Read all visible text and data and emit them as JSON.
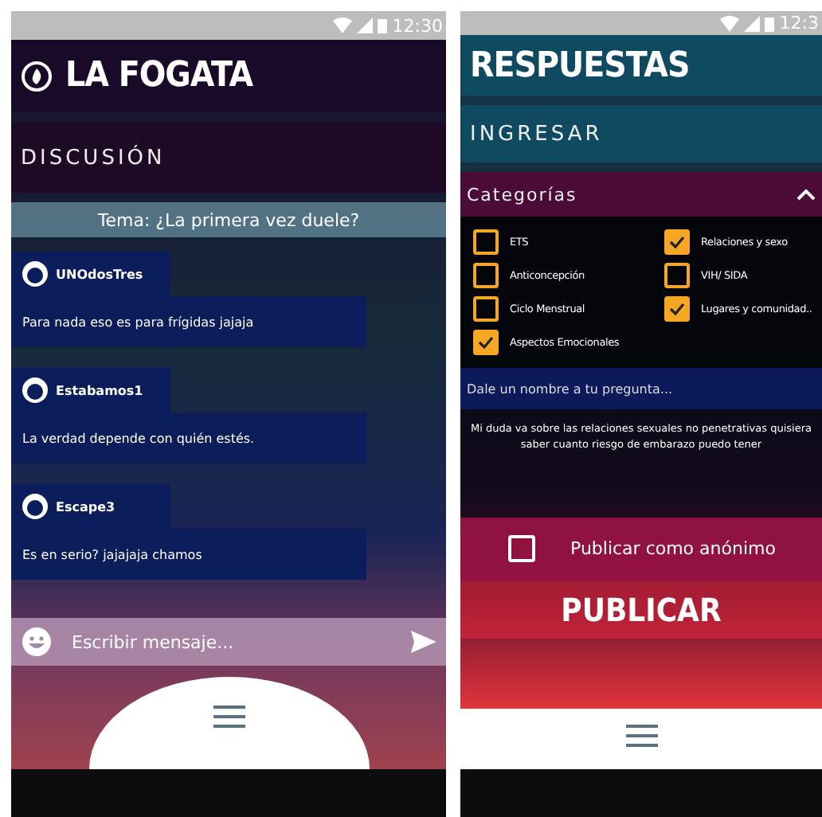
{
  "discussion_screen": {
    "status_bar": {
      "time": "12:30"
    },
    "app_title": "LA FOGATA",
    "section_title": "DISCUSIÓN",
    "topic": "Tema: ¿La primera vez duele?",
    "messages": [
      {
        "user": "UNOdosTres",
        "text": "Para nada eso es para frígidas jajaja"
      },
      {
        "user": "Estabamos1",
        "text": "La verdad depende con quién estés."
      },
      {
        "user": "Escape3",
        "text": "Es en serio? jajajaja chamos"
      }
    ],
    "message_input": {
      "placeholder": "Escribir mensaje..."
    }
  },
  "question_screen": {
    "status_bar": {
      "time": "12:3"
    },
    "title": "RESPUESTAS",
    "section_title": "INGRESAR",
    "categories": {
      "label": "Categorías",
      "expanded": true,
      "items": [
        {
          "label": "ETS",
          "checked": false
        },
        {
          "label": "Relaciones y sexo",
          "checked": true
        },
        {
          "label": "Anticoncepción",
          "checked": false
        },
        {
          "label": "VIH/ SIDA",
          "checked": false
        },
        {
          "label": "Ciclo Menstrual",
          "checked": false
        },
        {
          "label": "Lugares y comunidad..",
          "checked": true
        },
        {
          "label": "Aspectos Emocionales",
          "checked": true
        }
      ]
    },
    "question_name": {
      "placeholder": "Dale un nombre a tu pregunta..."
    },
    "question_text": "Mi duda va sobre las relaciones sexuales no penetrativas quisiera saber cuanto riesgo de embarazo puedo tener",
    "anonymous": {
      "label": "Publicar como anónimo",
      "checked": false
    },
    "publish_button": "PUBLICAR"
  }
}
